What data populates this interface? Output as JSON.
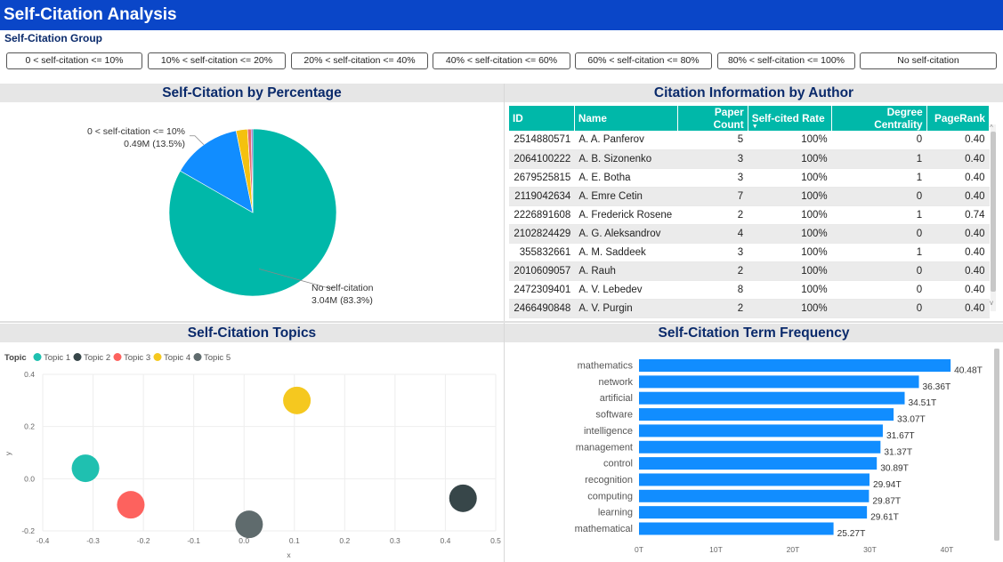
{
  "header": {
    "title": "Self-Citation Analysis"
  },
  "slicer": {
    "label": "Self-Citation Group",
    "options": [
      "0 < self-citation <= 10%",
      "10% < self-citation <= 20%",
      "20% < self-citation <= 40%",
      "40% < self-citation <= 60%",
      "60% < self-citation <= 80%",
      "80% < self-citation <= 100%",
      "No self-citation"
    ]
  },
  "panels": {
    "pie_title": "Self-Citation by Percentage",
    "table_title": "Citation Information by Author",
    "topics_title": "Self-Citation Topics",
    "terms_title": "Self-Citation Term Frequency"
  },
  "table": {
    "columns": [
      "ID",
      "Name",
      "Paper Count",
      "Self-cited Rate",
      "Degree Centrality",
      "PageRank"
    ],
    "rows": [
      [
        "2514880571",
        "A. A. Panferov",
        "5",
        "100%",
        "0",
        "0.40"
      ],
      [
        "2064100222",
        "A. B. Sizonenko",
        "3",
        "100%",
        "1",
        "0.40"
      ],
      [
        "2679525815",
        "A. E. Botha",
        "3",
        "100%",
        "1",
        "0.40"
      ],
      [
        "2119042634",
        "A. Emre Cetin",
        "7",
        "100%",
        "0",
        "0.40"
      ],
      [
        "2226891608",
        "A. Frederick Rosene",
        "2",
        "100%",
        "1",
        "0.74"
      ],
      [
        "2102824429",
        "A. G. Aleksandrov",
        "4",
        "100%",
        "0",
        "0.40"
      ],
      [
        "355832661",
        "A. M. Saddeek",
        "3",
        "100%",
        "1",
        "0.40"
      ],
      [
        "2010609057",
        "A. Rauh",
        "2",
        "100%",
        "0",
        "0.40"
      ],
      [
        "2472309401",
        "A. V. Lebedev",
        "8",
        "100%",
        "0",
        "0.40"
      ],
      [
        "2466490848",
        "A. V. Purgin",
        "2",
        "100%",
        "0",
        "0.40"
      ]
    ]
  },
  "chart_data": [
    {
      "type": "pie",
      "labels": [
        "No self-citation",
        "0 < self-citation <= 10%",
        "10% < self-citation <= 20%",
        "20% < self-citation <= 40%",
        "40% < self-citation <= 60%"
      ],
      "values": [
        83.3,
        13.5,
        2.2,
        0.7,
        0.3
      ],
      "colors": [
        "#00b8a9",
        "#118dff",
        "#f4c10f",
        "#e66c6c",
        "#8a4fbf"
      ],
      "data_labels": [
        {
          "name": "No self-citation",
          "value": "3.04M (83.3%)"
        },
        {
          "name": "0 < self-citation <= 10%",
          "value": "0.49M (13.5%)"
        }
      ]
    },
    {
      "type": "scatter",
      "legend_title": "Topic",
      "xlabel": "x",
      "ylabel": "y",
      "xlim": [
        -0.4,
        0.5
      ],
      "ylim": [
        -0.2,
        0.4
      ],
      "xticks": [
        "-0.4",
        "-0.3",
        "-0.2",
        "-0.1",
        "0.0",
        "0.1",
        "0.2",
        "0.3",
        "0.4",
        "0.5"
      ],
      "yticks": [
        "0.4",
        "0.2",
        "0.0",
        "-0.2"
      ],
      "series": [
        {
          "name": "Topic 1",
          "color": "#1fc0b0",
          "x": -0.315,
          "y": 0.04
        },
        {
          "name": "Topic 2",
          "color": "#374649",
          "x": 0.435,
          "y": -0.075
        },
        {
          "name": "Topic 3",
          "color": "#fd625e",
          "x": -0.225,
          "y": -0.1
        },
        {
          "name": "Topic 4",
          "color": "#f5c81f",
          "x": 0.105,
          "y": 0.3
        },
        {
          "name": "Topic 5",
          "color": "#5f6b6d",
          "x": 0.01,
          "y": -0.175
        }
      ]
    },
    {
      "type": "bar",
      "orientation": "horizontal",
      "color": "#118dff",
      "categories": [
        "mathematics",
        "network",
        "artificial",
        "software",
        "intelligence",
        "management",
        "control",
        "recognition",
        "computing",
        "learning",
        "mathematical"
      ],
      "values": [
        40.48,
        36.36,
        34.51,
        33.07,
        31.67,
        31.37,
        30.89,
        29.94,
        29.87,
        29.61,
        25.27
      ],
      "value_labels": [
        "40.48T",
        "36.36T",
        "34.51T",
        "33.07T",
        "31.67T",
        "31.37T",
        "30.89T",
        "29.94T",
        "29.87T",
        "29.61T",
        "25.27T"
      ],
      "xticks": [
        "0T",
        "10T",
        "20T",
        "30T",
        "40T"
      ],
      "xlim": [
        0,
        40
      ]
    }
  ]
}
